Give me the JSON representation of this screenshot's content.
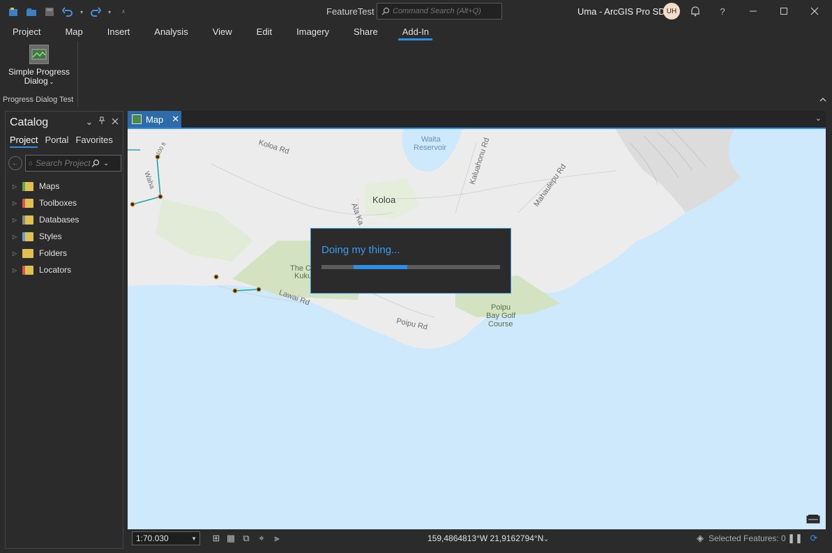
{
  "titlebar": {
    "document_title": "FeatureTest",
    "search_placeholder": "Command Search (Alt+Q)",
    "user_label": "Uma - ArcGIS Pro SDK",
    "avatar_initials": "UH",
    "help_label": "?"
  },
  "ribbon": {
    "tabs": [
      {
        "label": "Project"
      },
      {
        "label": "Map"
      },
      {
        "label": "Insert"
      },
      {
        "label": "Analysis"
      },
      {
        "label": "View"
      },
      {
        "label": "Edit"
      },
      {
        "label": "Imagery"
      },
      {
        "label": "Share"
      },
      {
        "label": "Add-In"
      }
    ],
    "active_tab": "Add-In",
    "button_label_line1": "Simple Progress",
    "button_label_line2": "Dialog",
    "group_label": "Progress Dialog Test"
  },
  "catalog": {
    "title": "Catalog",
    "tabs": [
      {
        "label": "Project"
      },
      {
        "label": "Portal"
      },
      {
        "label": "Favorites"
      }
    ],
    "search_placeholder": "Search Project",
    "items": [
      {
        "label": "Maps",
        "color": "#5aa84f"
      },
      {
        "label": "Toolboxes",
        "color": "#d9534f"
      },
      {
        "label": "Databases",
        "color": "#e0c050"
      },
      {
        "label": "Styles",
        "color": "#e0c050"
      },
      {
        "label": "Folders",
        "color": "#e0c050"
      },
      {
        "label": "Locators",
        "color": "#d9534f"
      }
    ]
  },
  "map": {
    "tab_label": "Map",
    "labels": {
      "waita": "Waita",
      "reservoir": "Reservoir",
      "koloa_rd": "Koloa Rd",
      "koloa": "Koloa",
      "ala_kalanikaumaka": "Ala Ka",
      "kaluahonu_rd": "Kaluahonu Rd",
      "mahaulepu_rd": "Mahaulepu Rd",
      "the_club_kukuiula_1": "The C",
      "the_club_kukuiula_2": "Kuku",
      "lawai_rd": "Lawai Rd",
      "poipu_rd": "Poipu Rd",
      "poipu_bay_1": "Poipu",
      "poipu_bay_2": "Bay Golf",
      "poipu_bay_3": "Course",
      "waha": "Waha",
      "hundred_ft": "100 ft"
    }
  },
  "progress_dialog": {
    "message": "Doing my thing...",
    "progress_start": 0.18,
    "progress_end": 0.48
  },
  "statusbar": {
    "scale": "1:70.030",
    "coordinates": "159,4864813°W 21,9162794°N",
    "selected_features": "Selected Features: 0"
  },
  "colors": {
    "accent": "#2d8ee6",
    "water": "#cde9fb",
    "land": "#ececec",
    "park": "#d3e3c2"
  }
}
